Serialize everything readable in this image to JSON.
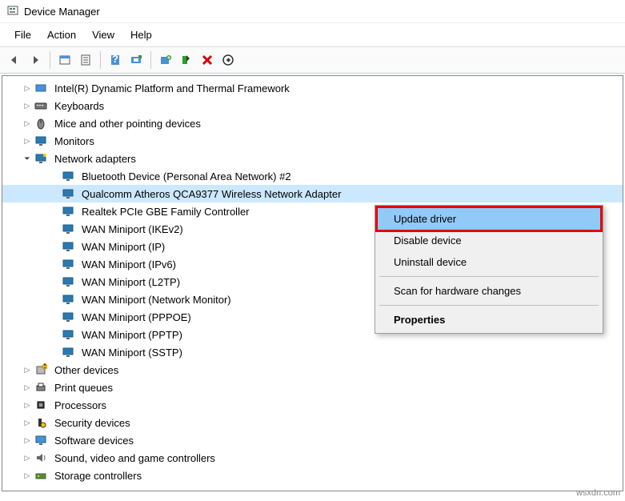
{
  "title": "Device Manager",
  "menu": {
    "file": "File",
    "action": "Action",
    "view": "View",
    "help": "Help"
  },
  "tree": {
    "intel_platform": "Intel(R) Dynamic Platform and Thermal Framework",
    "keyboards": "Keyboards",
    "mice": "Mice and other pointing devices",
    "monitors": "Monitors",
    "network_adapters": "Network adapters",
    "na": {
      "bluetooth": "Bluetooth Device (Personal Area Network) #2",
      "qualcomm": "Qualcomm Atheros QCA9377 Wireless Network Adapter",
      "realtek": "Realtek PCIe GBE Family Controller",
      "wan_ikev2": "WAN Miniport (IKEv2)",
      "wan_ip": "WAN Miniport (IP)",
      "wan_ipv6": "WAN Miniport (IPv6)",
      "wan_l2tp": "WAN Miniport (L2TP)",
      "wan_netmon": "WAN Miniport (Network Monitor)",
      "wan_pppoe": "WAN Miniport (PPPOE)",
      "wan_pptp": "WAN Miniport (PPTP)",
      "wan_sstp": "WAN Miniport (SSTP)"
    },
    "other_devices": "Other devices",
    "print_queues": "Print queues",
    "processors": "Processors",
    "security_devices": "Security devices",
    "software_devices": "Software devices",
    "sound": "Sound, video and game controllers",
    "storage": "Storage controllers"
  },
  "context": {
    "update": "Update driver",
    "disable": "Disable device",
    "uninstall": "Uninstall device",
    "scan": "Scan for hardware changes",
    "properties": "Properties"
  },
  "watermark": "wsxdn.com"
}
